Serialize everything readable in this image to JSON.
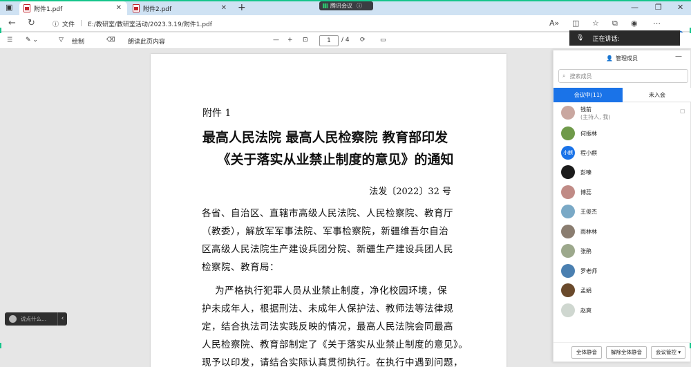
{
  "browser": {
    "tabs": [
      {
        "label": "附件1.pdf",
        "active": true
      },
      {
        "label": "附件2.pdf",
        "active": false
      }
    ],
    "meeting_pill": "腾讯会议",
    "address_label": "文件",
    "url": "E:/教研室/教研室活动/2023.3.19/附件1.pdf",
    "speaking": "正在讲话:",
    "accent": "#15c58b"
  },
  "pdf_toolbar": {
    "draw": "绘制",
    "read_aloud": "朗读此页内容",
    "page_current": "1",
    "page_total": "/ 4"
  },
  "document": {
    "attachment": "附件 1",
    "title_line1": "最高人民法院  最高人民检察院  教育部印发",
    "title_line2": "《关于落实从业禁止制度的意见》的通知",
    "doc_number": "法发〔2022〕32 号",
    "lines": [
      "各省、自治区、直辖市高级人民法院、人民检察院、教育厅",
      "（教委），解放军军事法院、军事检察院，新疆维吾尔自治",
      "区高级人民法院生产建设兵团分院、新疆生产建设兵团人民",
      "检察院、教育局：",
      "    为严格执行犯罪人员从业禁止制度，净化校园环境，保",
      "护未成年人，根据刑法、未成年人保护法、教师法等法律规",
      "定，结合执法司法实践反映的情况，最高人民法院会同最高",
      "人民检察院、教育部制定了《关于落实从业禁止制度的意见》。",
      "现予以印发，请结合实际认真贯彻执行。在执行中遇到问题，"
    ]
  },
  "mini_bar": {
    "text": "说点什么..."
  },
  "members_panel": {
    "header": "管理成员",
    "search_placeholder": "搜索成员",
    "tab_in_meeting": "会议中(11)",
    "tab_not_joined": "未入会",
    "members": [
      {
        "name": "钱前",
        "sub": "(主持人, 我)",
        "color": "#c9a7a0"
      },
      {
        "name": "何振林",
        "color": "#6f9a4a"
      },
      {
        "name": "程小麒",
        "color": "#1a73e8",
        "avatar_text": "小麒"
      },
      {
        "name": "彭嗪",
        "color": "#1b1b1b"
      },
      {
        "name": "博蕊",
        "color": "#c08b86"
      },
      {
        "name": "王俊杰",
        "color": "#7aa9c6"
      },
      {
        "name": "雨林林",
        "color": "#8a7d70"
      },
      {
        "name": "张鹃",
        "color": "#9ca88c"
      },
      {
        "name": "罗老师",
        "color": "#4a7fb0"
      },
      {
        "name": "孟娟",
        "color": "#6a4a2c"
      },
      {
        "name": "赵爽",
        "color": "#cfd7d0"
      }
    ],
    "btn_mute_all": "全体静音",
    "btn_unmute_all": "解除全体静音",
    "btn_control": "会议管控"
  }
}
